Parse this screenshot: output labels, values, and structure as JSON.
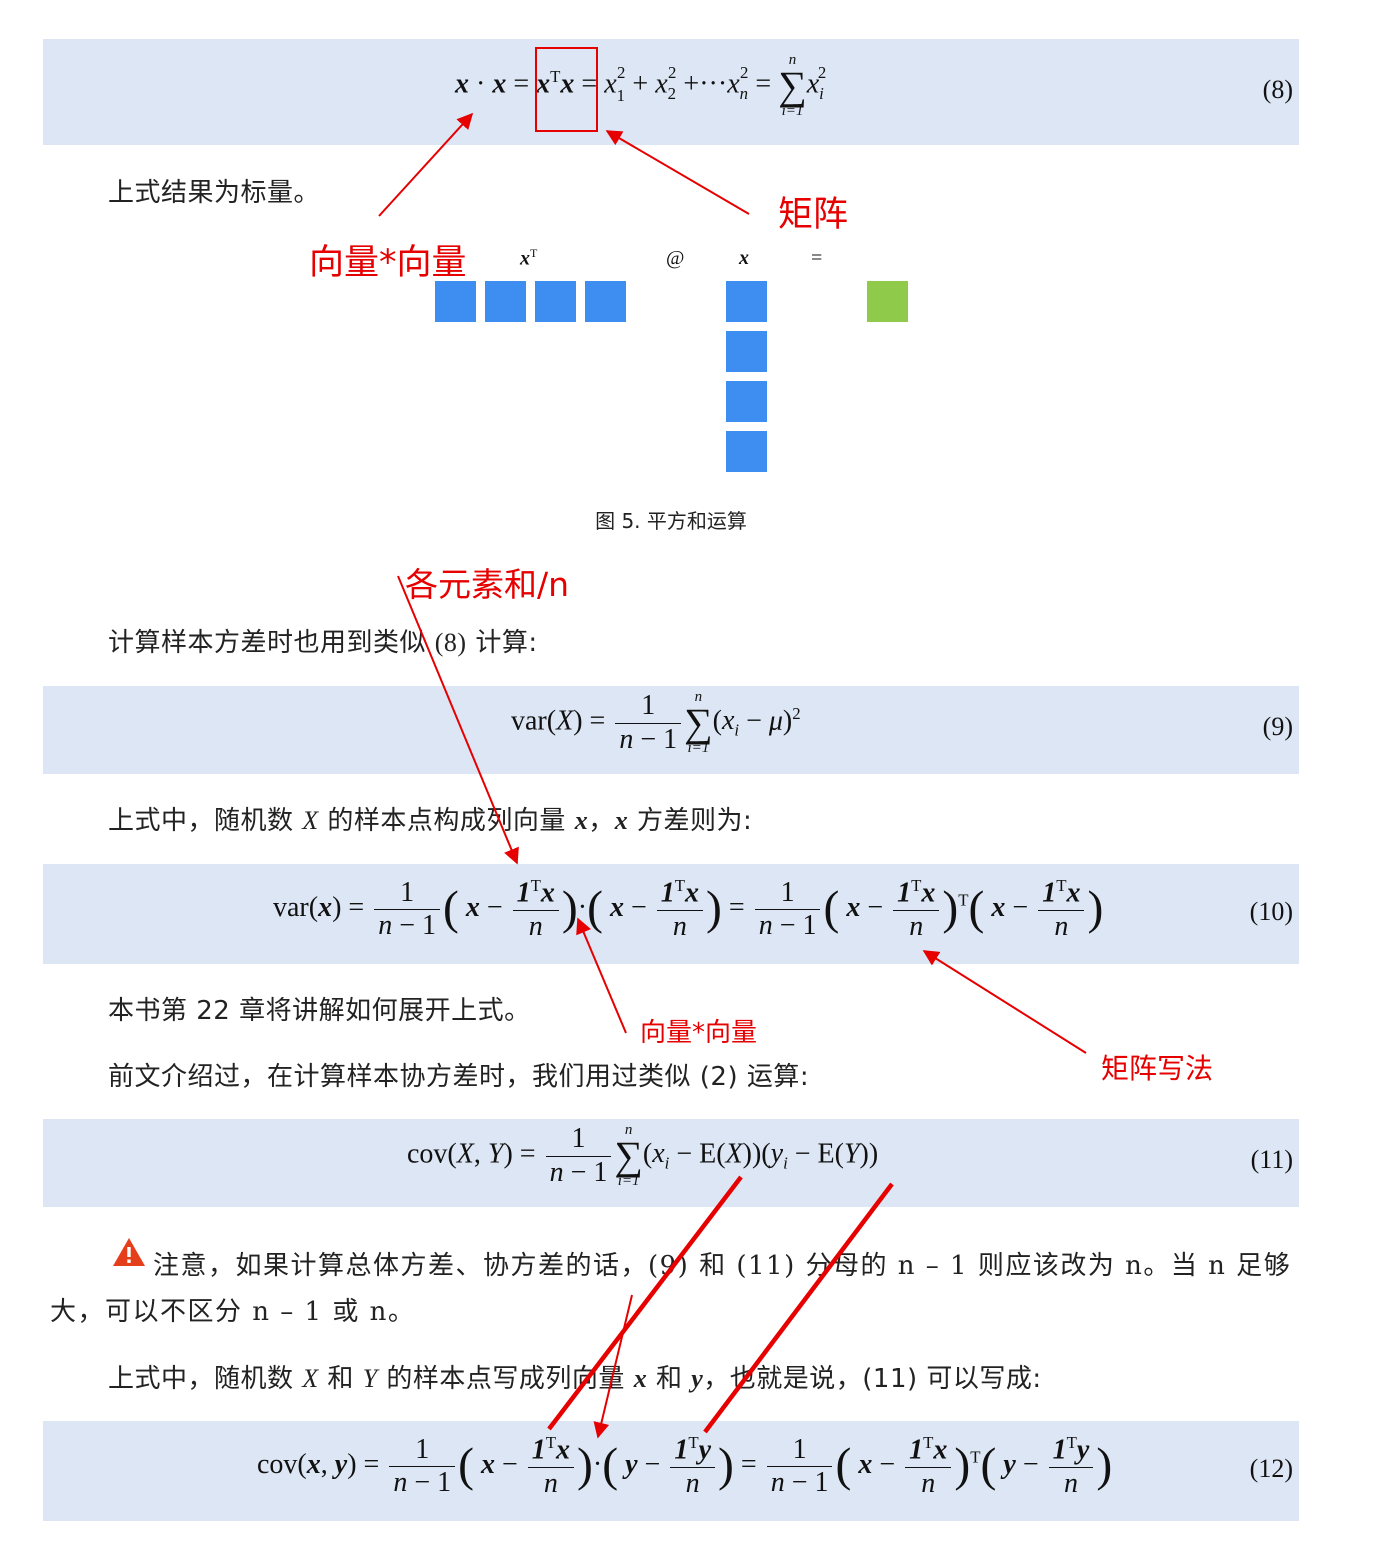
{
  "equations": {
    "eq8_num": "(8)",
    "eq9_num": "(9)",
    "eq10_num": "(10)",
    "eq11_num": "(11)",
    "eq12_num": "(12)"
  },
  "paragraphs": {
    "p1": "上式结果为标量。",
    "p2_pre": "计算样本方差时也用到类似 ",
    "p2_ref": "(8)",
    "p2_post": " 计算:",
    "p3_a": "上式中，随机数 ",
    "p3_b": " 的样本点构成列向量 ",
    "p3_c": "，",
    "p3_d": " 方差则为:",
    "p4": "本书第 22 章将讲解如何展开上式。",
    "p5": "前文介绍过，在计算样本协方差时，我们用过类似 (2) 运算:",
    "note_line1": "注意，如果计算总体方差、协方差的话，(9) 和 (11) 分母的 n – 1 则应该改为 n。当 n 足够",
    "note_line2": "大，可以不区分 n – 1 或 n。",
    "p6_a": "上式中，随机数 ",
    "p6_b": " 和 ",
    "p6_c": " 的样本点写成列向量 ",
    "p6_d": " 和 ",
    "p6_e": "，也就是说，(11) 可以写成:"
  },
  "figure": {
    "label_xt": "x",
    "label_t": "T",
    "label_at": "@",
    "label_x": "x",
    "label_eq": "=",
    "caption": "图 5. 平方和运算",
    "colors": {
      "vector": "#3e8ef2",
      "result": "#8fca4a"
    }
  },
  "annotations": {
    "vec_vec_1": "向量*向量",
    "matrix": "矩阵",
    "elem_sum": "各元素和/n",
    "vec_vec_2": "向量*向量",
    "matrix_notation": "矩阵写法",
    "color": "#e60000"
  }
}
